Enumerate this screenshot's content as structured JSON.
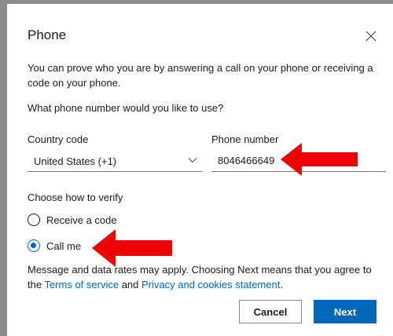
{
  "dialog": {
    "title": "Phone",
    "intro": "You can prove who you are by answering a call on your phone or receiving a code on your phone.",
    "question": "What phone number would you like to use?"
  },
  "form": {
    "country_label": "Country code",
    "country_value": "United States (+1)",
    "phone_label": "Phone number",
    "phone_value": "8046466649",
    "verify_label": "Choose how to verify",
    "options": [
      {
        "label": "Receive a code",
        "selected": false
      },
      {
        "label": "Call me",
        "selected": true
      }
    ]
  },
  "fine_print": {
    "text_before": "Message and data rates may apply. Choosing Next means that you agree to the ",
    "terms_link": "Terms of service",
    "middle": " and ",
    "privacy_link": "Privacy and cookies statement",
    "end": "."
  },
  "buttons": {
    "cancel": "Cancel",
    "next": "Next"
  },
  "icons": {
    "close": "close-icon",
    "dropdown": "chevron-down-icon"
  },
  "colors": {
    "accent": "#0067b8",
    "annotation_arrow": "#ee0000"
  }
}
